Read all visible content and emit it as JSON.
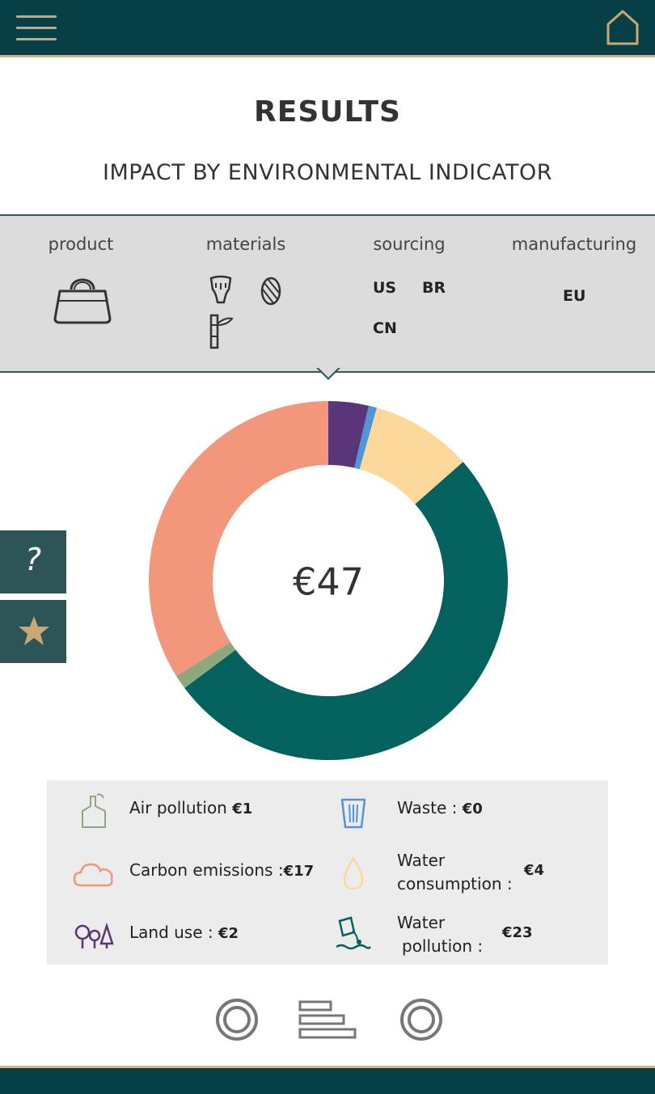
{
  "header": {
    "menu_icon": "hamburger-menu-icon",
    "home_icon": "home-icon"
  },
  "page": {
    "title": "RESULTS",
    "subtitle": "IMPACT BY ENVIRONMENTAL INDICATOR"
  },
  "filters": {
    "product": {
      "label": "product",
      "icon": "handbag-icon"
    },
    "materials": {
      "label": "materials",
      "icons": [
        "leather-icon",
        "yarn-icon",
        "bamboo-icon"
      ]
    },
    "sourcing": {
      "label": "sourcing",
      "codes": [
        "US",
        "BR",
        "CN"
      ]
    },
    "manufacturing": {
      "label": "manufacturing",
      "codes": [
        "EU"
      ]
    }
  },
  "side": {
    "help_label": "?",
    "favorite_icon": "star-icon"
  },
  "total": "€47",
  "chart_data": {
    "type": "pie",
    "categories": [
      "Air pollution",
      "Carbon emissions",
      "Land use",
      "Waste",
      "Water consumption",
      "Water pollution"
    ],
    "values": [
      1,
      17,
      2,
      0,
      4,
      23
    ],
    "order": [
      "Land use",
      "Waste",
      "Water consumption",
      "Water pollution",
      "Air pollution",
      "Carbon emissions"
    ],
    "order_values": [
      1.7,
      0.35,
      4.3,
      24.1,
      0.6,
      15.95
    ],
    "colors": {
      "Land use": "#5a3577",
      "Waste": "#4f95d8",
      "Water consumption": "#fdd89b",
      "Water pollution": "#03625d",
      "Air pollution": "#8fa77c",
      "Carbon emissions": "#f2967c"
    }
  },
  "legend": [
    {
      "name": "Air pollution",
      "text": "Air pollution",
      "value": "€1",
      "icon": "factory-icon"
    },
    {
      "name": "Waste",
      "text": "Waste :",
      "value": "€0",
      "icon": "trash-bin-icon"
    },
    {
      "name": "Carbon emissions",
      "text": "Carbon emissions :",
      "value": "€17",
      "icon": "cloud-icon"
    },
    {
      "name": "Water consumption",
      "text1": "Water",
      "text2": "consumption :",
      "value": "€4",
      "icon": "water-drop-icon"
    },
    {
      "name": "Land use",
      "text": "Land use :",
      "value": "€2",
      "icon": "trees-icon"
    },
    {
      "name": "Water pollution",
      "text1": "Water",
      "text2": "pollution :",
      "value": "€23",
      "icon": "water-pollution-icon"
    }
  ],
  "toolbar": {
    "icons": [
      "donut-view-icon",
      "bar-view-icon",
      "donut-alt-view-icon"
    ]
  }
}
